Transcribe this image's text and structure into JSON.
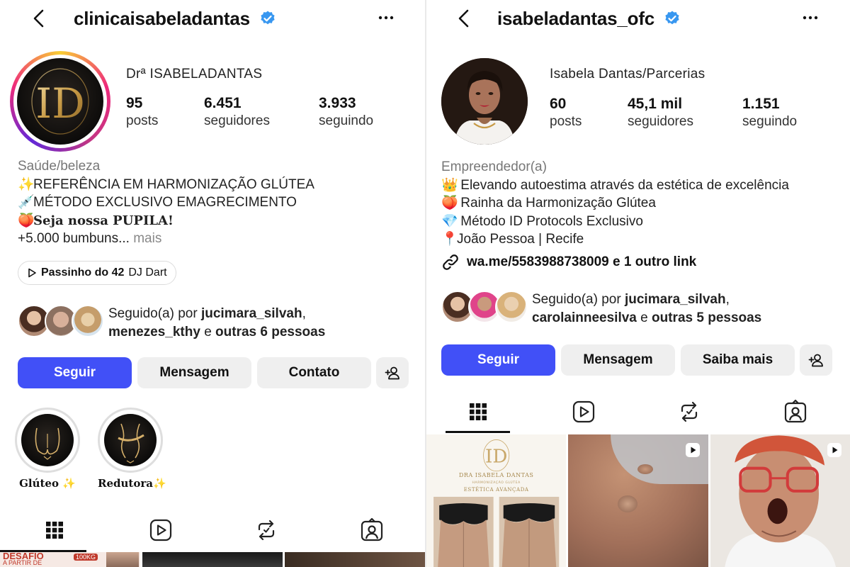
{
  "left": {
    "username": "clinicaisabeladantas",
    "display_name": "Drª ISABELADANTAS",
    "logo_text": "ID",
    "stats": [
      {
        "num": "95",
        "label": "posts"
      },
      {
        "num": "6.451",
        "label": "seguidores"
      },
      {
        "num": "3.933",
        "label": "seguindo"
      }
    ],
    "bio": {
      "category": "Saúde/beleza",
      "line1_emoji": "✨",
      "line1": "REFERÊNCIA EM HARMONIZAÇÃO GLÚTEA",
      "line2_emoji": "💉",
      "line2": "MÉTODO EXCLUSIVO EMAGRECIMENTO",
      "line3_emoji": "🍑",
      "line3": "Seja nossa PUPILA!",
      "line4": "+5.000 bumbuns...",
      "more": "mais"
    },
    "music": {
      "title": "Passinho do 42",
      "artist": "DJ Dart"
    },
    "followed": {
      "prefix": "Seguido(a) por",
      "user1": "jucimara_silvah",
      "sep": ",",
      "user2": "menezes_kthy",
      "conj": "e",
      "others": "outras 6 pessoas"
    },
    "buttons": {
      "follow": "Seguir",
      "message": "Mensagem",
      "contact": "Contato"
    },
    "highlights": [
      {
        "label": "Glúteo",
        "emoji": "✨"
      },
      {
        "label": "Redutora",
        "emoji": "✨"
      }
    ],
    "grid_text": {
      "c1a": "DESAFIO",
      "c1b": "A PARTIR DE",
      "c1c": "100KG"
    }
  },
  "right": {
    "username": "isabeladantas_ofc",
    "display_name": "Isabela Dantas/Parcerias",
    "stats": [
      {
        "num": "60",
        "label": "posts"
      },
      {
        "num": "45,1 mil",
        "label": "seguidores"
      },
      {
        "num": "1.151",
        "label": "seguindo"
      }
    ],
    "bio": {
      "category": "Empreendedor(a)",
      "line1_emoji": "👑",
      "line1": "Elevando autoestima através da estética de excelência",
      "line2_emoji": "🍑",
      "line2": "Rainha da Harmonização Glútea",
      "line3_emoji": "💎",
      "line3": "Método ID Protocols Exclusivo",
      "line4_emoji": "📍",
      "line4": "João Pessoa | Recife",
      "link": "wa.me/5583988738009 e 1 outro link"
    },
    "followed": {
      "prefix": "Seguido(a) por",
      "user1": "jucimara_silvah",
      "sep": ",",
      "user2": "carolainneesilva",
      "conj": "e",
      "others": "outras 5 pessoas"
    },
    "buttons": {
      "follow": "Seguir",
      "message": "Mensagem",
      "more": "Saiba mais"
    },
    "post1": {
      "logo": "ID",
      "name": "DRA ISABELA DANTAS",
      "sub": "HARMONIZAÇÃO GLÚTEA",
      "sub2": "ESTÉTICA AVANÇADA"
    }
  },
  "colors": {
    "primary_button": "#4150f7",
    "verified_badge": "#3897f0",
    "secondary_button": "#efefef"
  }
}
